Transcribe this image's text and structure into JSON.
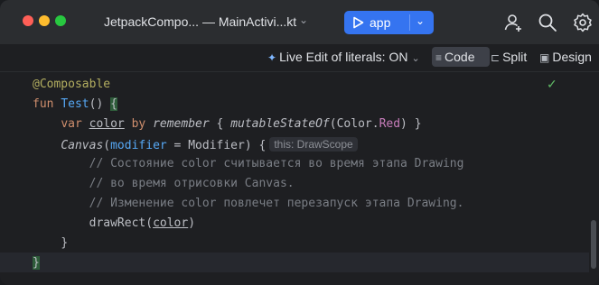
{
  "titlebar": {
    "project_title": "JetpackCompo... — MainActivi...kt",
    "run_config": "app"
  },
  "toolbar": {
    "live_edit": "Live Edit of literals: ON",
    "modes": {
      "code": "Code",
      "split": "Split",
      "design": "Design"
    }
  },
  "editor": {
    "lines": [
      {
        "annotation": "@Composable"
      },
      {
        "kw": "fun",
        "name": "Test",
        "rest": "() ",
        "brace": "{"
      },
      {
        "kw": "var",
        "var": "color",
        "by": "by",
        "remember": "remember",
        "ob": "{",
        "mutable": "mutableStateOf",
        "args_open": "(Color.",
        "red": "Red",
        "args_close": ") }"
      },
      {
        "canvas": "Canvas",
        "open": "(",
        "modifier": "modifier",
        "eq": " = Modifier) {",
        "hint": "this: DrawScope"
      },
      {
        "comment": "// Состояние color считывается во время этапа Drawing"
      },
      {
        "comment": "// во время отрисовки Canvas."
      },
      {
        "comment": "// Изменение color повлечет перезапуск этапа Drawing."
      },
      {
        "call": "drawRect(",
        "arg": "color",
        "close": ")"
      },
      {
        "text": "}"
      },
      {
        "text": "}"
      }
    ]
  },
  "icons": {
    "add_user": "add-user-icon",
    "search": "search-icon",
    "settings": "gear-icon",
    "inspection_ok": "check-icon"
  }
}
